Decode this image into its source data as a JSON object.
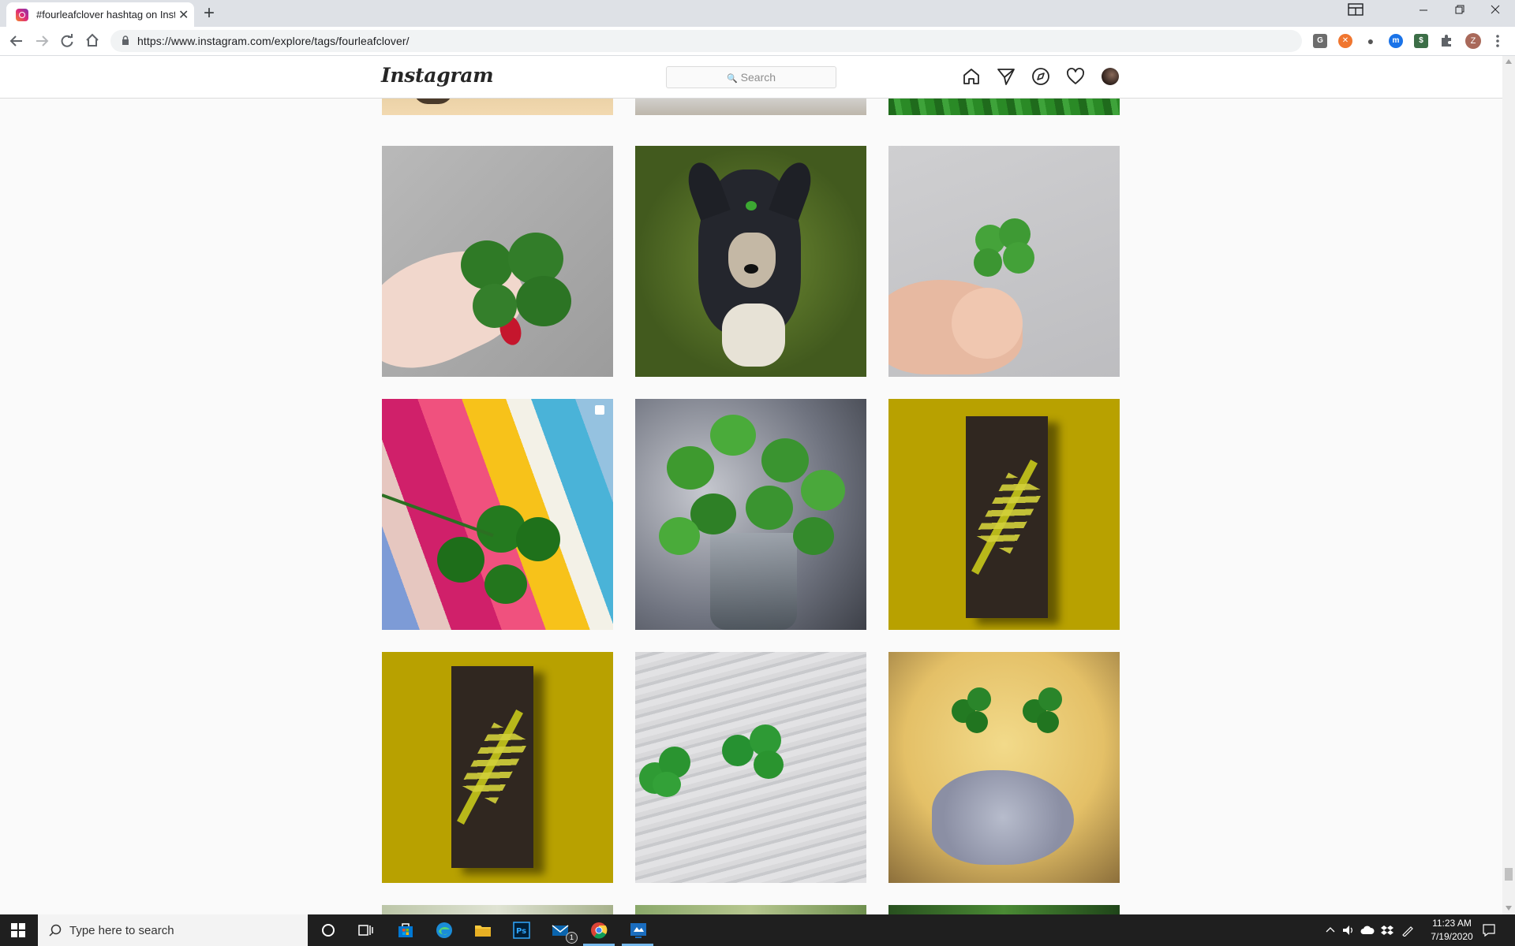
{
  "browser": {
    "tab_title": "#fourleafclover hashtag on Insta",
    "new_tab_symbol": "+",
    "close_symbol": "✕",
    "url": "https://www.instagram.com/explore/tags/fourleafclover/",
    "profile_initial": "Z",
    "extensions": [
      {
        "name": "grammar-extension",
        "color": "#6d6d6d",
        "glyph": "G"
      },
      {
        "name": "orange-extension",
        "color": "#f0762f",
        "glyph": "✕"
      },
      {
        "name": "circle-extension",
        "color": "#555555",
        "glyph": "●"
      },
      {
        "name": "blue-extension",
        "color": "#1a73e8",
        "glyph": "m"
      },
      {
        "name": "green-extension",
        "color": "#3c6e47",
        "glyph": "$"
      }
    ]
  },
  "instagram": {
    "logo": "Instagram",
    "search_placeholder": "Search"
  },
  "grid": {
    "tiles": [
      {
        "row": 0,
        "col": 0,
        "description_icon": "partial-photo"
      },
      {
        "row": 1,
        "col": 0,
        "subject": "hand holding four-leaf clover"
      },
      {
        "row": 1,
        "col": 1,
        "subject": "dog with clover on head"
      },
      {
        "row": 1,
        "col": 2,
        "subject": "fingers holding small clover"
      },
      {
        "row": 2,
        "col": 0,
        "subject": "clover on striped leather"
      },
      {
        "row": 2,
        "col": 1,
        "subject": "clovers in glass vase"
      },
      {
        "row": 2,
        "col": 2,
        "subject": "leaf on soil, mustard background"
      },
      {
        "row": 3,
        "col": 0,
        "subject": "leaf on soil, mustard background"
      },
      {
        "row": 3,
        "col": 1,
        "subject": "clovers on wooden table"
      },
      {
        "row": 3,
        "col": 2,
        "subject": "clover face on grapefruit"
      }
    ]
  },
  "taskbar": {
    "search_placeholder": "Type here to search",
    "time": "11:23 AM",
    "date": "7/19/2020",
    "mail_badge": "1"
  }
}
